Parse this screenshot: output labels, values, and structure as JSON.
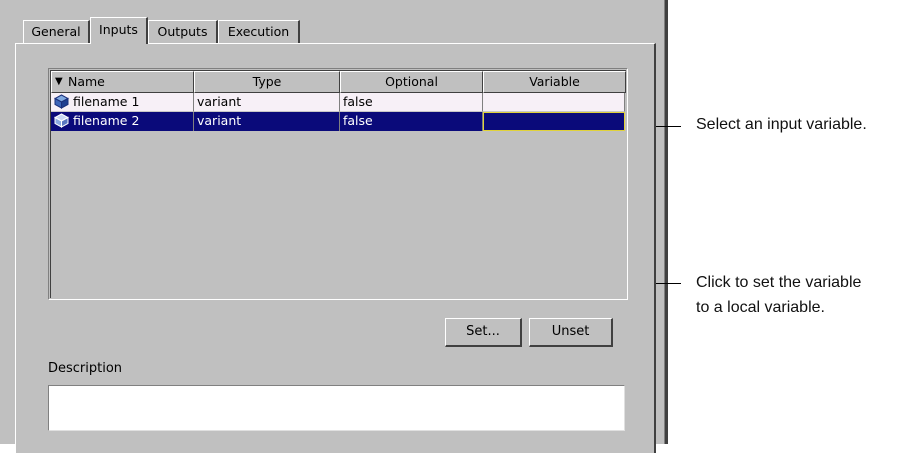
{
  "tabs": [
    {
      "label": "General",
      "active": false
    },
    {
      "label": "Inputs",
      "active": true
    },
    {
      "label": "Outputs",
      "active": false
    },
    {
      "label": "Execution",
      "active": false
    }
  ],
  "table": {
    "columns": [
      "Name",
      "Type",
      "Optional",
      "Variable"
    ],
    "sort_indicator": "triangle-down-icon",
    "rows": [
      {
        "name": "filename 1",
        "type": "variant",
        "optional": "false",
        "variable": "",
        "selected": false
      },
      {
        "name": "filename 2",
        "type": "variant",
        "optional": "false",
        "variable": "",
        "selected": true
      }
    ]
  },
  "buttons": {
    "set": "Set...",
    "unset": "Unset"
  },
  "description": {
    "label": "Description",
    "value": ""
  },
  "callouts": {
    "select": "Select an input variable.",
    "set_line1": "Click to set the variable",
    "set_line2": "to a local variable."
  },
  "colors": {
    "dialog_bg": "#c0c0c0",
    "selection": "#0a0a7a",
    "focus_outline": "#e0d23a",
    "row_bg": "#f7f0f7"
  }
}
